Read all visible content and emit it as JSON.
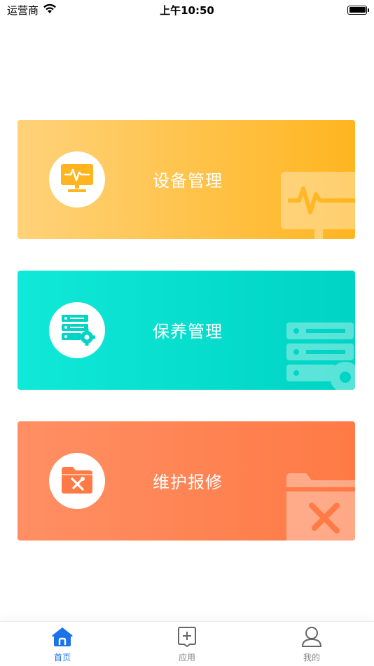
{
  "status_bar": {
    "carrier": "运营商",
    "time": "上午10:50"
  },
  "cards": [
    {
      "label": "设备管理",
      "icon": "monitor-pulse-icon",
      "color": "#ffb520"
    },
    {
      "label": "保养管理",
      "icon": "server-gear-icon",
      "color": "#00d4c4"
    },
    {
      "label": "维护报修",
      "icon": "folder-tools-icon",
      "color": "#ff7a45"
    }
  ],
  "tab_bar": {
    "items": [
      {
        "label": "首页",
        "icon": "home-icon",
        "active": true
      },
      {
        "label": "应用",
        "icon": "add-app-icon",
        "active": false
      },
      {
        "label": "我的",
        "icon": "user-icon",
        "active": false
      }
    ],
    "active_color": "#1a73e8",
    "inactive_color": "#888888"
  }
}
